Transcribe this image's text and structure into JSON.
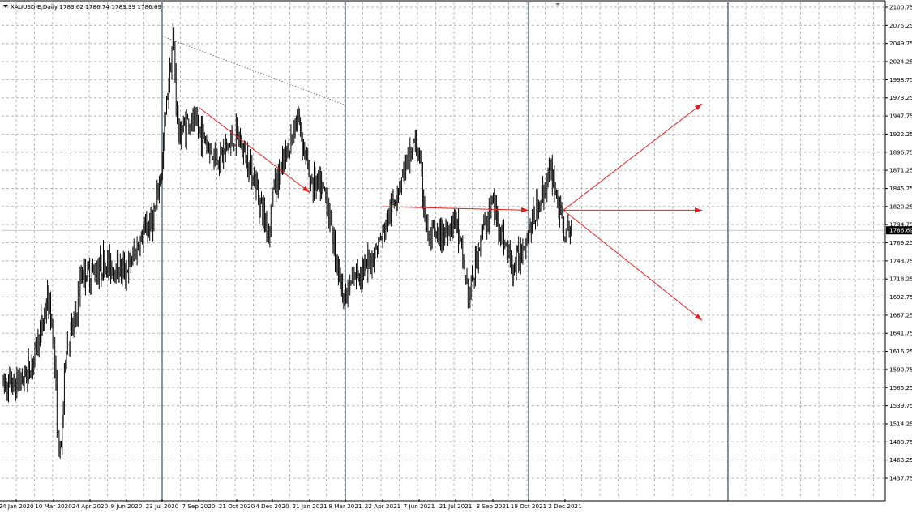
{
  "chart_data": {
    "type": "candlestick",
    "title": "XAUUSD-E,Daily  1783.62 1786.74 1783.39 1786.69",
    "symbol": "XAUUSD-E",
    "timeframe": "Daily",
    "ohlc_header": {
      "open": 1783.62,
      "high": 1786.74,
      "low": 1783.39,
      "close": 1786.69
    },
    "current_price": 1786.69,
    "current_price_label": "1786.69",
    "ylim": [
      1437.75,
      2100.75
    ],
    "y_ticks": [
      "2100.75",
      "2075.25",
      "2049.75",
      "2024.25",
      "1998.75",
      "1973.25",
      "1947.75",
      "1922.25",
      "1896.75",
      "1871.25",
      "1845.75",
      "1820.25",
      "1794.75",
      "1769.25",
      "1743.75",
      "1718.25",
      "1692.75",
      "1667.25",
      "1641.75",
      "1616.25",
      "1590.75",
      "1565.25",
      "1539.75",
      "1514.25",
      "1488.75",
      "1463.25",
      "1437.75"
    ],
    "x_ticks": [
      "24 Jan 2020",
      "10 Mar 2020",
      "24 Apr 2020",
      "9 Jun 2020",
      "23 Jul 2020",
      "7 Sep 2020",
      "21 Oct 2020",
      "4 Dec 2020",
      "21 Jan 2021",
      "8 Mar 2021",
      "22 Apr 2021",
      "7 Jun 2021",
      "21 Jul 2021",
      "3 Sep 2021",
      "19 Oct 2021",
      "2 Dec 2021"
    ],
    "grid": true,
    "price_path": [
      [
        "24 Jan 2020",
        1570
      ],
      [
        "10 Feb 2020",
        1590
      ],
      [
        "24 Feb 2020",
        1650
      ],
      [
        "3 Mar 2020",
        1690
      ],
      [
        "10 Mar 2020",
        1640
      ],
      [
        "16 Mar 2020",
        1480
      ],
      [
        "19 Mar 2020",
        1470
      ],
      [
        "25 Mar 2020",
        1620
      ],
      [
        "6 Apr 2020",
        1660
      ],
      [
        "14 Apr 2020",
        1730
      ],
      [
        "24 Apr 2020",
        1725
      ],
      [
        "12 May 2020",
        1740
      ],
      [
        "9 Jun 2020",
        1730
      ],
      [
        "30 Jun 2020",
        1780
      ],
      [
        "14 Jul 2020",
        1810
      ],
      [
        "23 Jul 2020",
        1880
      ],
      [
        "28 Jul 2020",
        1960
      ],
      [
        "6 Aug 2020",
        2060
      ],
      [
        "12 Aug 2020",
        1920
      ],
      [
        "25 Aug 2020",
        1940
      ],
      [
        "7 Sep 2020",
        1930
      ],
      [
        "21 Sep 2020",
        1900
      ],
      [
        "1 Oct 2020",
        1890
      ],
      [
        "21 Oct 2020",
        1920
      ],
      [
        "9 Nov 2020",
        1870
      ],
      [
        "30 Nov 2020",
        1780
      ],
      [
        "4 Dec 2020",
        1840
      ],
      [
        "16 Dec 2020",
        1870
      ],
      [
        "6 Jan 2021",
        1950
      ],
      [
        "21 Jan 2021",
        1860
      ],
      [
        "10 Feb 2021",
        1840
      ],
      [
        "1 Mar 2021",
        1720
      ],
      [
        "8 Mar 2021",
        1690
      ],
      [
        "22 Mar 2021",
        1730
      ],
      [
        "1 Apr 2021",
        1730
      ],
      [
        "22 Apr 2021",
        1780
      ],
      [
        "18 May 2021",
        1870
      ],
      [
        "1 Jun 2021",
        1910
      ],
      [
        "7 Jun 2021",
        1890
      ],
      [
        "17 Jun 2021",
        1780
      ],
      [
        "1 Jul 2021",
        1775
      ],
      [
        "21 Jul 2021",
        1805
      ],
      [
        "6 Aug 2021",
        1690
      ],
      [
        "20 Aug 2021",
        1780
      ],
      [
        "3 Sep 2021",
        1825
      ],
      [
        "29 Sep 2021",
        1730
      ],
      [
        "19 Oct 2021",
        1785
      ],
      [
        "12 Nov 2021",
        1860
      ],
      [
        "16 Nov 2021",
        1870
      ],
      [
        "2 Dec 2021",
        1780
      ],
      [
        "10 Dec 2021",
        1786.69
      ]
    ],
    "annotations": {
      "vertical_lines": [
        "23 Jul 2020",
        "8 Mar 2021",
        "19 Oct 2021",
        "future"
      ],
      "dotted_trendline": [
        [
          "23 Jul 2020",
          2060
        ],
        [
          "8 Mar 2021",
          1963
        ]
      ],
      "red_arrows": [
        {
          "from": [
            "7 Sep 2020",
            1960
          ],
          "to": [
            "21 Jan 2021",
            1840
          ]
        },
        {
          "from": [
            "22 Apr 2021",
            1820
          ],
          "to": [
            "19 Oct 2021",
            1815
          ]
        },
        {
          "from": [
            "2 Dec 2021",
            1815
          ],
          "to": [
            "future",
            1965
          ]
        },
        {
          "from": [
            "2 Dec 2021",
            1815
          ],
          "to": [
            "future",
            1815
          ]
        },
        {
          "from": [
            "2 Dec 2021",
            1815
          ],
          "to": [
            "future",
            1660
          ]
        }
      ]
    }
  },
  "colors": {
    "background": "#ffffff",
    "grid": "#b8b8b8",
    "candles": "#000000",
    "vertical_lines": "#5a6a78",
    "arrows": "#e02020",
    "price_badge": "#000000"
  }
}
